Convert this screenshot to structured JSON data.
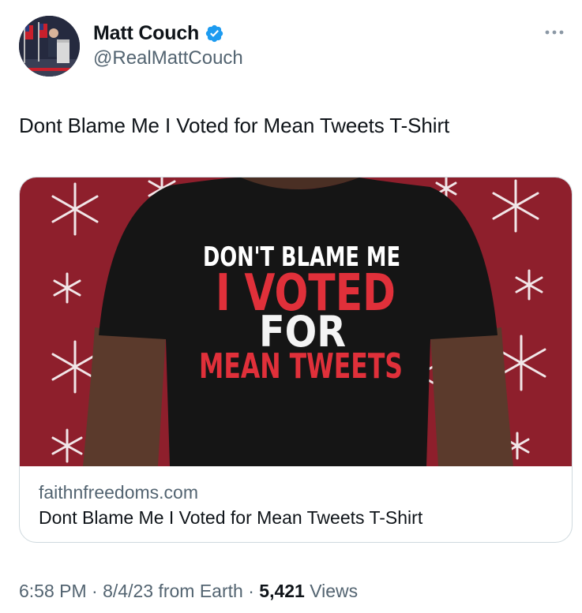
{
  "author": {
    "display_name": "Matt Couch",
    "handle": "@RealMattCouch",
    "verified": true,
    "verified_color": "#1d9bf0"
  },
  "tweet": {
    "text": "Dont Blame Me I Voted for Mean Tweets T-Shirt"
  },
  "card": {
    "domain": "faithnfreedoms.com",
    "title": "Dont Blame Me I Voted for Mean Tweets T-Shirt",
    "image": {
      "background_color": "#8e1f2c",
      "shirt_color": "#141414",
      "shirt_lines": [
        "DON'T BLAME ME",
        "I VOTED",
        "FOR",
        "MEAN TWEETS"
      ],
      "accent_red": "#e0303a"
    }
  },
  "meta": {
    "time": "6:58 PM",
    "separator": " · ",
    "date": "8/4/23",
    "source": "from Earth",
    "views_count": "5,421",
    "views_label": "Views"
  },
  "icons": {
    "more": "more-horizontal-icon",
    "verified": "verified-badge-icon"
  }
}
